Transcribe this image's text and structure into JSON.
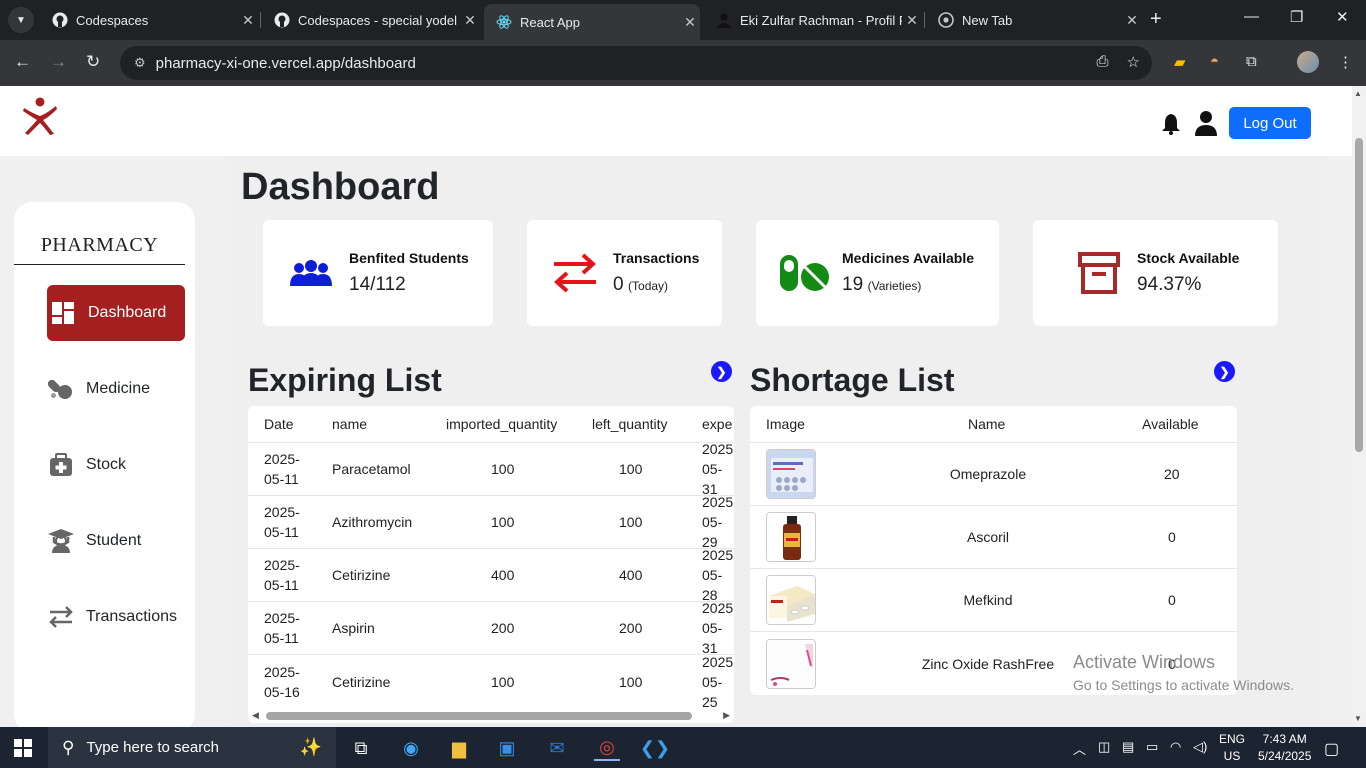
{
  "browser": {
    "tabs": [
      {
        "title": "Codespaces",
        "icon": "github-icon"
      },
      {
        "title": "Codespaces - special yodel",
        "icon": "github-icon"
      },
      {
        "title": "React App",
        "icon": "react-icon"
      },
      {
        "title": "Eki Zulfar Rachman - Profil P",
        "icon": "profile-icon"
      },
      {
        "title": "New Tab",
        "icon": "chrome-icon"
      }
    ],
    "url": "pharmacy-xi-one.vercel.app/dashboard"
  },
  "header": {
    "logout_label": "Log Out"
  },
  "sidebar": {
    "brand": "PHARMACY",
    "items": [
      {
        "label": "Dashboard",
        "icon": "dashboard-icon",
        "active": true
      },
      {
        "label": "Medicine",
        "icon": "pills-icon"
      },
      {
        "label": "Stock",
        "icon": "medkit-icon"
      },
      {
        "label": "Student",
        "icon": "student-icon"
      },
      {
        "label": "Transactions",
        "icon": "exchange-icon"
      }
    ]
  },
  "main": {
    "title": "Dashboard",
    "stats": [
      {
        "label": "Benfited Students",
        "value": "14/112",
        "sub": "",
        "icon": "users-icon",
        "color": "#0d1fd6"
      },
      {
        "label": "Transactions",
        "value": "0",
        "sub": "(Today)",
        "icon": "exchange-icon",
        "color": "#e8131a"
      },
      {
        "label": "Medicines Available",
        "value": "19",
        "sub": "(Varieties)",
        "icon": "pills-icon",
        "color": "#138a13"
      },
      {
        "label": "Stock Available",
        "value": "94.37%",
        "sub": "",
        "icon": "archive-icon",
        "color": "#a52a2a"
      }
    ],
    "expiring": {
      "title": "Expiring List",
      "columns": [
        "Date",
        "name",
        "imported_quantity",
        "left_quantity",
        "expe"
      ],
      "rows": [
        {
          "date": [
            "2025-",
            "05-11"
          ],
          "name": "Paracetamol",
          "imported": "100",
          "left": "100",
          "exp": [
            "2025",
            "05-31"
          ]
        },
        {
          "date": [
            "2025-",
            "05-11"
          ],
          "name": "Azithromycin",
          "imported": "100",
          "left": "100",
          "exp": [
            "2025",
            "05-29"
          ]
        },
        {
          "date": [
            "2025-",
            "05-11"
          ],
          "name": "Cetirizine",
          "imported": "400",
          "left": "400",
          "exp": [
            "2025",
            "05-28"
          ]
        },
        {
          "date": [
            "2025-",
            "05-11"
          ],
          "name": "Aspirin",
          "imported": "200",
          "left": "200",
          "exp": [
            "2025",
            "05-31"
          ]
        },
        {
          "date": [
            "2025-",
            "05-16"
          ],
          "name": "Cetirizine",
          "imported": "100",
          "left": "100",
          "exp": [
            "2025",
            "05-25"
          ]
        }
      ]
    },
    "shortage": {
      "title": "Shortage List",
      "columns": [
        "Image",
        "Name",
        "Available"
      ],
      "rows": [
        {
          "name": "Omeprazole",
          "available": "20"
        },
        {
          "name": "Ascoril",
          "available": "0"
        },
        {
          "name": "Mefkind",
          "available": "0"
        },
        {
          "name": "Zinc Oxide RashFree",
          "available": "0"
        }
      ]
    }
  },
  "watermark": {
    "line1": "Activate Windows",
    "line2": "Go to Settings to activate Windows."
  },
  "taskbar": {
    "search_placeholder": "Type here to search",
    "lang": [
      "ENG",
      "US"
    ],
    "time": "7:43 AM",
    "date": "5/24/2025"
  }
}
